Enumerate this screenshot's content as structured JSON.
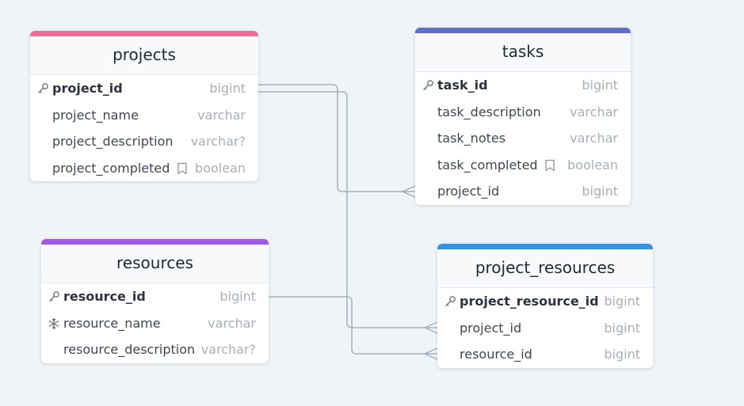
{
  "colors": {
    "background": "#eff4f7",
    "link": "#a5b1be",
    "projects_accent": "#ee6f9a",
    "tasks_accent": "#5f6fcb",
    "resources_accent": "#9d5ce0",
    "project_resources_accent": "#3b8fdb"
  },
  "tables": {
    "projects": {
      "name": "projects",
      "fields": [
        {
          "name": "project_id",
          "type": "bigint",
          "icon": "key-icon",
          "pk": true
        },
        {
          "name": "project_name",
          "type": "varchar"
        },
        {
          "name": "project_description",
          "type": "varchar?"
        },
        {
          "name": "project_completed",
          "type": "boolean",
          "note": "bookmark-icon"
        }
      ]
    },
    "tasks": {
      "name": "tasks",
      "fields": [
        {
          "name": "task_id",
          "type": "bigint",
          "icon": "key-icon",
          "pk": true
        },
        {
          "name": "task_description",
          "type": "varchar"
        },
        {
          "name": "task_notes",
          "type": "varchar"
        },
        {
          "name": "task_completed",
          "type": "boolean",
          "note": "bookmark-icon"
        },
        {
          "name": "project_id",
          "type": "bigint"
        }
      ]
    },
    "resources": {
      "name": "resources",
      "fields": [
        {
          "name": "resource_id",
          "type": "bigint",
          "icon": "key-icon",
          "pk": true
        },
        {
          "name": "resource_name",
          "type": "varchar",
          "icon": "snowflake-icon"
        },
        {
          "name": "resource_description",
          "type": "varchar?"
        }
      ]
    },
    "project_resources": {
      "name": "project_resources",
      "fields": [
        {
          "name": "project_resource_id",
          "type": "bigint",
          "icon": "key-icon",
          "pk": true
        },
        {
          "name": "project_id",
          "type": "bigint"
        },
        {
          "name": "resource_id",
          "type": "bigint"
        }
      ]
    }
  },
  "relationships": [
    {
      "from": "projects.project_id",
      "to": "tasks.project_id",
      "cardinality": "one-to-many"
    },
    {
      "from": "projects.project_id",
      "to": "project_resources.project_id",
      "cardinality": "one-to-many"
    },
    {
      "from": "resources.resource_id",
      "to": "project_resources.resource_id",
      "cardinality": "one-to-many"
    }
  ]
}
